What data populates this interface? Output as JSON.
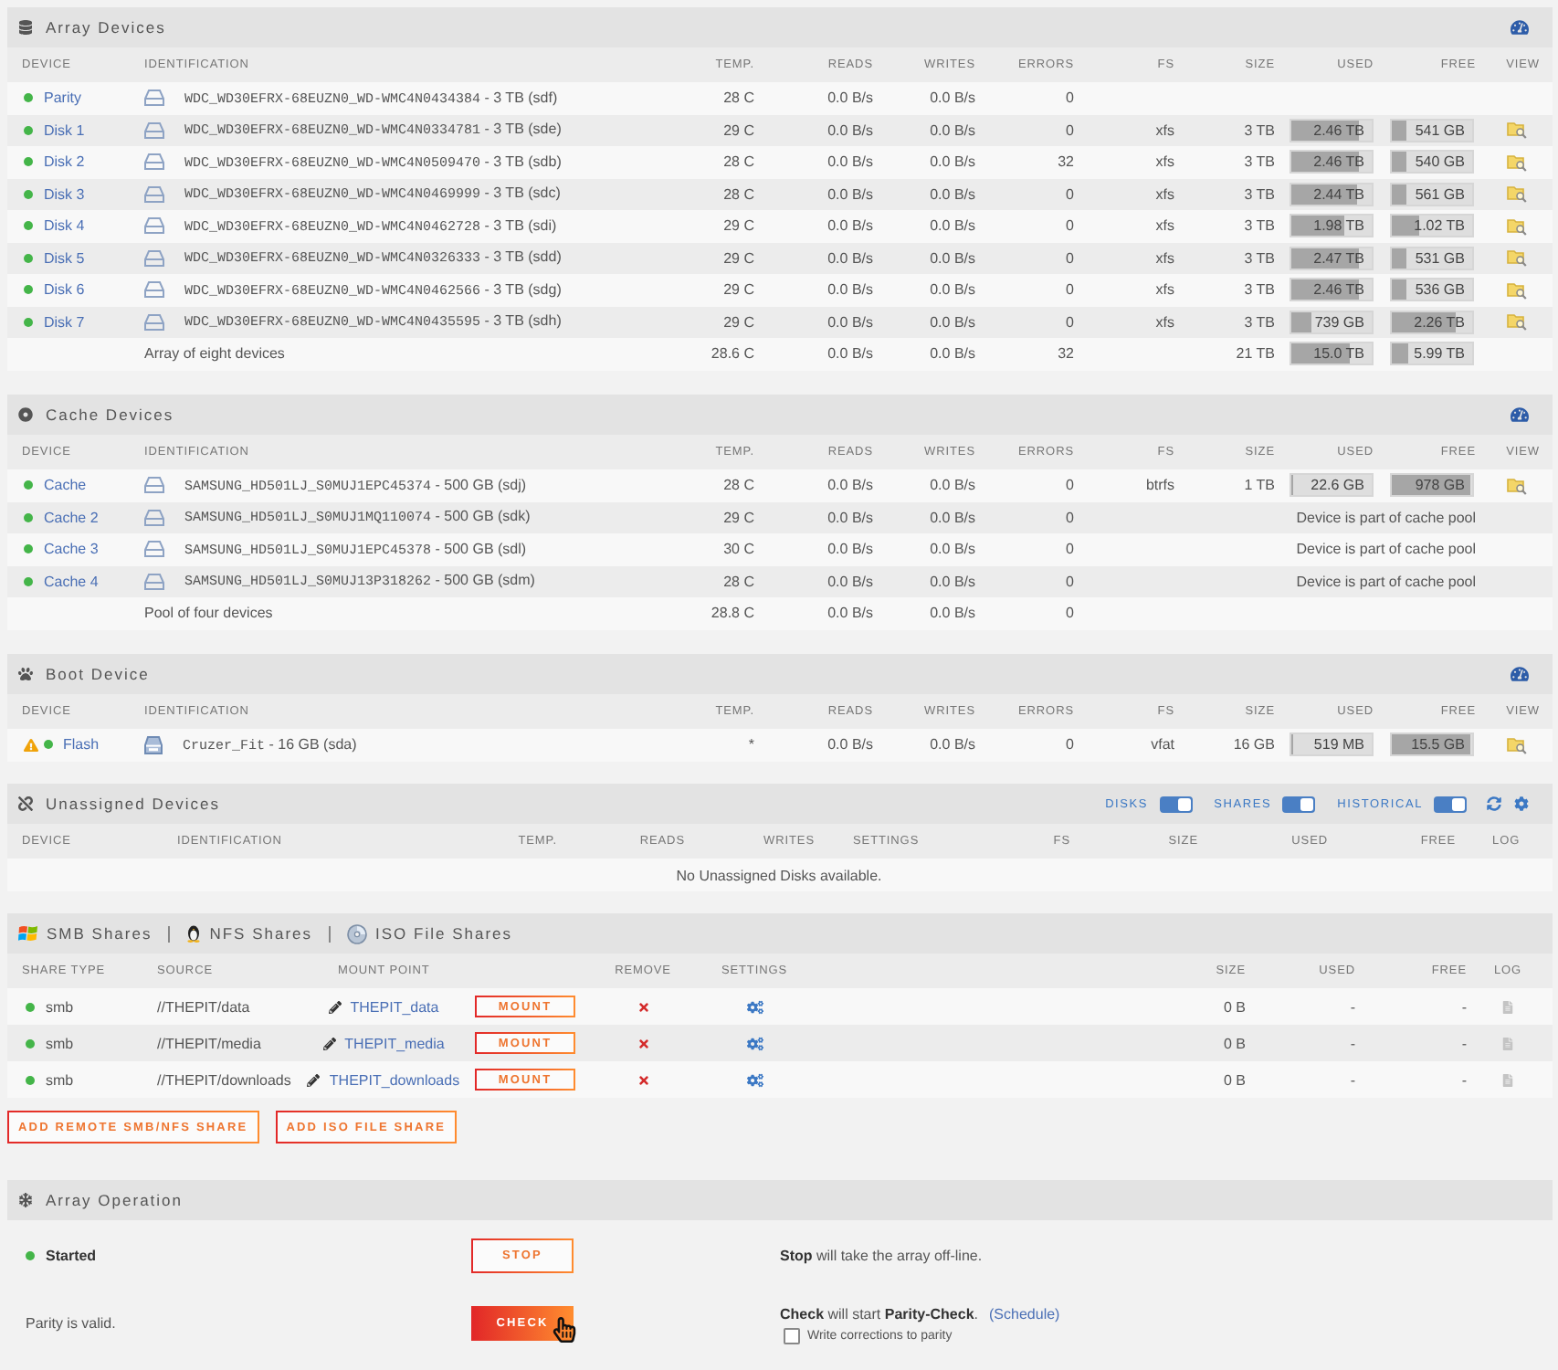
{
  "array_devices": {
    "title": "Array Devices",
    "columns": [
      "DEVICE",
      "IDENTIFICATION",
      "TEMP.",
      "READS",
      "WRITES",
      "ERRORS",
      "FS",
      "SIZE",
      "USED",
      "FREE",
      "VIEW"
    ],
    "rows": [
      {
        "device": "Parity",
        "color": "#44b549",
        "model": "WDC_WD30EFRX-68EUZN0_WD-WMC4N0434384",
        "capacity": "- 3 TB (sdf)",
        "temp": "28 C",
        "reads": "0.0 B/s",
        "writes": "0.0 B/s",
        "errors": "0"
      },
      {
        "device": "Disk 1",
        "color": "#44b549",
        "model": "WDC_WD30EFRX-68EUZN0_WD-WMC4N0334781",
        "capacity": "- 3 TB (sde)",
        "temp": "29 C",
        "reads": "0.0 B/s",
        "writes": "0.0 B/s",
        "errors": "0",
        "fs": "xfs",
        "size": "3 TB",
        "used": {
          "text": "2.46 TB",
          "level": 0.83
        },
        "free": {
          "text": "541 GB",
          "level": 0.18
        }
      },
      {
        "device": "Disk 2",
        "color": "#44b549",
        "model": "WDC_WD30EFRX-68EUZN0_WD-WMC4N0509470",
        "capacity": "- 3 TB (sdb)",
        "temp": "28 C",
        "reads": "0.0 B/s",
        "writes": "0.0 B/s",
        "errors": "32",
        "fs": "xfs",
        "size": "3 TB",
        "used": {
          "text": "2.46 TB",
          "level": 0.83
        },
        "free": {
          "text": "540 GB",
          "level": 0.18
        }
      },
      {
        "device": "Disk 3",
        "color": "#44b549",
        "model": "WDC_WD30EFRX-68EUZN0_WD-WMC4N0469999",
        "capacity": "- 3 TB (sdc)",
        "temp": "28 C",
        "reads": "0.0 B/s",
        "writes": "0.0 B/s",
        "errors": "0",
        "fs": "xfs",
        "size": "3 TB",
        "used": {
          "text": "2.44 TB",
          "level": 0.81
        },
        "free": {
          "text": "561 GB",
          "level": 0.19
        }
      },
      {
        "device": "Disk 4",
        "color": "#44b549",
        "model": "WDC_WD30EFRX-68EUZN0_WD-WMC4N0462728",
        "capacity": "- 3 TB (sdi)",
        "temp": "29 C",
        "reads": "0.0 B/s",
        "writes": "0.0 B/s",
        "errors": "0",
        "fs": "xfs",
        "size": "3 TB",
        "used": {
          "text": "1.98 TB",
          "level": 0.65
        },
        "free": {
          "text": "1.02 TB",
          "level": 0.35
        }
      },
      {
        "device": "Disk 5",
        "color": "#44b549",
        "model": "WDC_WD30EFRX-68EUZN0_WD-WMC4N0326333",
        "capacity": "- 3 TB (sdd)",
        "temp": "29 C",
        "reads": "0.0 B/s",
        "writes": "0.0 B/s",
        "errors": "0",
        "fs": "xfs",
        "size": "3 TB",
        "used": {
          "text": "2.47 TB",
          "level": 0.83
        },
        "free": {
          "text": "531 GB",
          "level": 0.18
        }
      },
      {
        "device": "Disk 6",
        "color": "#44b549",
        "model": "WDC_WD30EFRX-68EUZN0_WD-WMC4N0462566",
        "capacity": "- 3 TB (sdg)",
        "temp": "29 C",
        "reads": "0.0 B/s",
        "writes": "0.0 B/s",
        "errors": "0",
        "fs": "xfs",
        "size": "3 TB",
        "used": {
          "text": "2.46 TB",
          "level": 0.83
        },
        "free": {
          "text": "536 GB",
          "level": 0.18
        }
      },
      {
        "device": "Disk 7",
        "color": "#44b549",
        "model": "WDC_WD30EFRX-68EUZN0_WD-WMC4N0435595",
        "capacity": "- 3 TB (sdh)",
        "temp": "29 C",
        "reads": "0.0 B/s",
        "writes": "0.0 B/s",
        "errors": "0",
        "fs": "xfs",
        "size": "3 TB",
        "used": {
          "text": "739 GB",
          "level": 0.24
        },
        "free": {
          "text": "2.26 TB",
          "level": 0.8
        }
      }
    ],
    "summary": {
      "label": "Array of eight devices",
      "temp": "28.6 C",
      "reads": "0.0 B/s",
      "writes": "0.0 B/s",
      "errors": "32",
      "size": "21 TB",
      "used": {
        "text": "15.0 TB",
        "level": 0.72
      },
      "free": {
        "text": "5.99 TB",
        "level": 0.2
      }
    }
  },
  "cache_devices": {
    "title": "Cache Devices",
    "columns": [
      "DEVICE",
      "IDENTIFICATION",
      "TEMP.",
      "READS",
      "WRITES",
      "ERRORS",
      "FS",
      "SIZE",
      "USED",
      "FREE",
      "VIEW"
    ],
    "rows": [
      {
        "device": "Cache",
        "color": "#44b549",
        "model": "SAMSUNG_HD501LJ_S0MUJ1EPC45374",
        "capacity": "- 500 GB (sdj)",
        "temp": "28 C",
        "reads": "0.0 B/s",
        "writes": "0.0 B/s",
        "errors": "0",
        "fs": "btrfs",
        "size": "1 TB",
        "used": {
          "text": "22.6 GB",
          "level": 0.03
        },
        "free": {
          "text": "978 GB",
          "level": 0.98
        }
      },
      {
        "device": "Cache 2",
        "color": "#44b549",
        "model": "SAMSUNG_HD501LJ_S0MUJ1MQ110074",
        "capacity": "- 500 GB (sdk)",
        "temp": "29 C",
        "reads": "0.0 B/s",
        "writes": "0.0 B/s",
        "errors": "0",
        "note": "Device is part of cache pool"
      },
      {
        "device": "Cache 3",
        "color": "#44b549",
        "model": "SAMSUNG_HD501LJ_S0MUJ1EPC45378",
        "capacity": "- 500 GB (sdl)",
        "temp": "30 C",
        "reads": "0.0 B/s",
        "writes": "0.0 B/s",
        "errors": "0",
        "note": "Device is part of cache pool"
      },
      {
        "device": "Cache 4",
        "color": "#44b549",
        "model": "SAMSUNG_HD501LJ_S0MUJ13P318262",
        "capacity": "- 500 GB (sdm)",
        "temp": "28 C",
        "reads": "0.0 B/s",
        "writes": "0.0 B/s",
        "errors": "0",
        "note": "Device is part of cache pool"
      }
    ],
    "summary": {
      "label": "Pool of four devices",
      "temp": "28.8 C",
      "reads": "0.0 B/s",
      "writes": "0.0 B/s",
      "errors": "0"
    }
  },
  "boot_device": {
    "title": "Boot Device",
    "columns": [
      "DEVICE",
      "IDENTIFICATION",
      "TEMP.",
      "READS",
      "WRITES",
      "ERRORS",
      "FS",
      "SIZE",
      "USED",
      "FREE",
      "VIEW"
    ],
    "rows": [
      {
        "device": "Flash",
        "warning": true,
        "color": "#44b549",
        "model": "Cruzer_Fit",
        "capacity": "- 16 GB (sda)",
        "temp": "*",
        "reads": "0.0 B/s",
        "writes": "0.0 B/s",
        "errors": "0",
        "fs": "vfat",
        "size": "16 GB",
        "used": {
          "text": "519 MB",
          "level": 0.03
        },
        "free": {
          "text": "15.5 GB",
          "level": 0.97
        }
      }
    ]
  },
  "unassigned_devices": {
    "title": "Unassigned Devices",
    "toggles": [
      {
        "label": "DISKS",
        "on": true
      },
      {
        "label": "SHARES",
        "on": true
      },
      {
        "label": "HISTORICAL",
        "on": true
      }
    ],
    "columns": [
      "DEVICE",
      "IDENTIFICATION",
      "TEMP.",
      "READS",
      "WRITES",
      "SETTINGS",
      "FS",
      "SIZE",
      "USED",
      "FREE",
      "LOG"
    ],
    "message": "No Unassigned Disks available."
  },
  "shares": {
    "titles": [
      {
        "label": "SMB Shares",
        "kind": "smb"
      },
      {
        "label": "NFS Shares",
        "kind": "nfs"
      },
      {
        "label": "ISO File Shares",
        "kind": "iso"
      }
    ],
    "columns": [
      "SHARE TYPE",
      "SOURCE",
      "MOUNT POINT",
      "REMOVE",
      "SETTINGS",
      "SIZE",
      "USED",
      "FREE",
      "LOG"
    ],
    "rows": [
      {
        "type": "smb",
        "color": "#44b549",
        "source": "//THEPIT/data",
        "mount_point": "THEPIT_data",
        "action": "MOUNT",
        "size": "0 B",
        "used": "-",
        "free": "-"
      },
      {
        "type": "smb",
        "color": "#44b549",
        "source": "//THEPIT/media",
        "mount_point": "THEPIT_media",
        "action": "MOUNT",
        "size": "0 B",
        "used": "-",
        "free": "-"
      },
      {
        "type": "smb",
        "color": "#44b549",
        "source": "//THEPIT/downloads",
        "mount_point": "THEPIT_downloads",
        "action": "MOUNT",
        "size": "0 B",
        "used": "-",
        "free": "-"
      }
    ],
    "buttons": [
      "ADD REMOTE SMB/NFS SHARE",
      "ADD ISO FILE SHARE"
    ]
  },
  "array_operation": {
    "title": "Array Operation",
    "rows": [
      {
        "status": {
          "kind": "state",
          "label": "Started",
          "color": "#44b549"
        },
        "button": {
          "label": "STOP",
          "hovered": false
        },
        "description": "**Stop** will take the array off-line."
      },
      {
        "status": {
          "kind": "note",
          "label": "Parity is valid."
        },
        "button": {
          "label": "CHECK",
          "hovered": true
        },
        "description": "**Check** will start **Parity-Check**.",
        "link": "(Schedule)",
        "checkbox": {
          "label": "Write corrections to parity",
          "checked": false
        }
      }
    ]
  }
}
